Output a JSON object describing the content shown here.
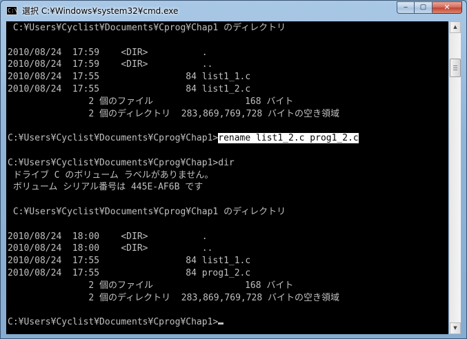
{
  "window": {
    "title": "選択 C:¥Windows¥system32¥cmd.exe",
    "app_icon_text": "C:\\",
    "icon": "cmd-icon"
  },
  "caption_buttons": {
    "minimize": "‒",
    "maximize": "▢",
    "close": "✕"
  },
  "console": {
    "lines": [
      " C:¥Users¥Cyclist¥Documents¥Cprog¥Chap1 のディレクトリ",
      "",
      "2010/08/24  17:59    <DIR>          .",
      "2010/08/24  17:59    <DIR>          ..",
      "2010/08/24  17:55                84 list1_1.c",
      "2010/08/24  17:55                84 list1_2.c",
      "               2 個のファイル                 168 バイト",
      "               2 個のディレクトリ  283,869,769,728 バイトの空き領域",
      "",
      "",
      "",
      "C:¥Users¥Cyclist¥Documents¥Cprog¥Chap1>dir",
      " ドライブ C のボリューム ラベルがありません。",
      " ボリューム シリアル番号は 445E-AF6B です",
      "",
      " C:¥Users¥Cyclist¥Documents¥Cprog¥Chap1 のディレクトリ",
      "",
      "2010/08/24  18:00    <DIR>          .",
      "2010/08/24  18:00    <DIR>          ..",
      "2010/08/24  17:55                84 list1_1.c",
      "2010/08/24  17:55                84 prog1_2.c",
      "               2 個のファイル                 168 バイト",
      "               2 個のディレクトリ  283,869,769,728 バイトの空き領域",
      "",
      "C:¥Users¥Cyclist¥Documents¥Cprog¥Chap1>"
    ],
    "selected_prompt": "C:¥Users¥Cyclist¥Documents¥Cprog¥Chap1>",
    "selected_command": "rename list1_2.c prog1_2.c",
    "selected_line_index": 9
  },
  "scrollbar": {
    "up_arrow": "▲",
    "down_arrow": "▼"
  }
}
